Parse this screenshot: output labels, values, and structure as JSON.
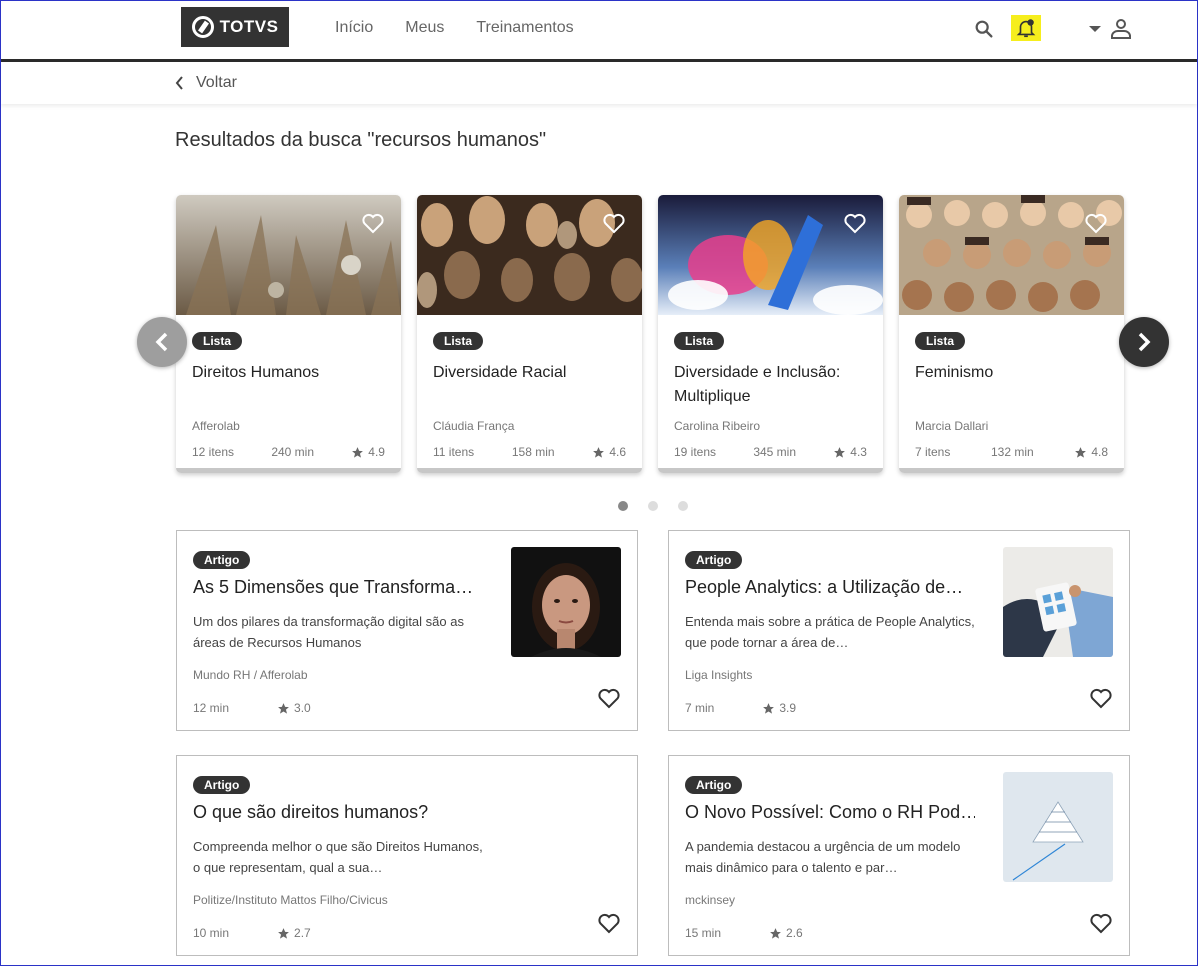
{
  "header": {
    "logo_text": "TOTVS",
    "nav": [
      "Início",
      "Meus",
      "Treinamentos"
    ],
    "icons": [
      "search-icon",
      "bell-icon",
      "chevron-down-icon",
      "user-icon"
    ],
    "bell_highlight_color": "#f6ee1d"
  },
  "back": {
    "label": "Voltar"
  },
  "results": {
    "title": "Resultados da busca \"recursos humanos\""
  },
  "carousel": {
    "cards": [
      {
        "type": "Lista",
        "title": "Direitos Humanos",
        "author": "Afferolab",
        "items": "12 itens",
        "duration": "240 min",
        "rating": "4.9"
      },
      {
        "type": "Lista",
        "title": "Diversidade Racial",
        "author": "Cláudia França",
        "items": "11 itens",
        "duration": "158 min",
        "rating": "4.6"
      },
      {
        "type": "Lista",
        "title": "Diversidade e Inclusão: Multiplique",
        "author": "Carolina Ribeiro",
        "items": "19 itens",
        "duration": "345 min",
        "rating": "4.3"
      },
      {
        "type": "Lista",
        "title": "Feminismo",
        "author": "Marcia Dallari",
        "items": "7 itens",
        "duration": "132 min",
        "rating": "4.8"
      }
    ],
    "page_count": 3,
    "active_page": 1
  },
  "articles": [
    {
      "type": "Artigo",
      "title": "As 5 Dimensões que Transforma…",
      "desc": "Um dos pilares da transformação digital são as áreas de Recursos Humanos",
      "source": "Mundo RH / Afferolab",
      "duration": "12 min",
      "rating": "3.0"
    },
    {
      "type": "Artigo",
      "title": "People Analytics: a Utilização de…",
      "desc": "Entenda mais sobre a prática de People Analytics, que pode tornar a área de…",
      "source": "Liga Insights",
      "duration": "7 min",
      "rating": "3.9"
    },
    {
      "type": "Artigo",
      "title": "O que são direitos humanos?",
      "desc": "Compreenda melhor o que são Direitos Humanos, o que representam, qual a sua…",
      "source": "Politize/Instituto Mattos Filho/Civicus",
      "duration": "10 min",
      "rating": "2.7"
    },
    {
      "type": "Artigo",
      "title": "O Novo Possível: Como o RH Pod…",
      "desc": "A pandemia destacou a urgência de um modelo mais dinâmico para o talento e par…",
      "source": "mckinsey",
      "duration": "15 min",
      "rating": "2.6"
    }
  ]
}
